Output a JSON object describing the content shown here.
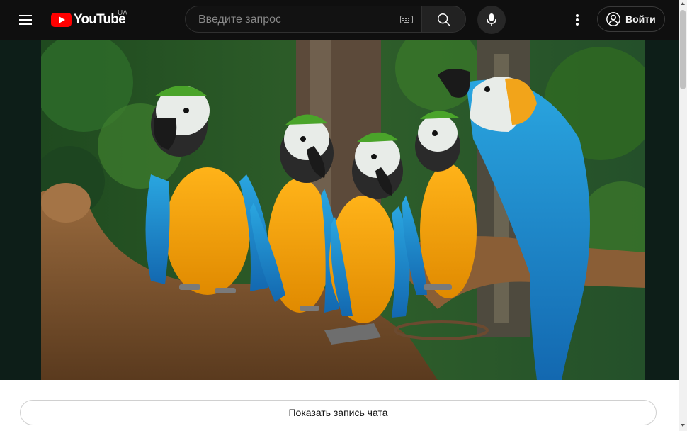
{
  "header": {
    "logo_text": "YouTube",
    "country_code": "UA",
    "search_placeholder": "Введите запрос",
    "signin_label": "Войти",
    "icons": [
      "menu-icon",
      "youtube-logo-icon",
      "keyboard-icon",
      "search-icon",
      "mic-icon",
      "more-vert-icon",
      "account-circle-icon"
    ]
  },
  "player": {
    "content_description_icon": "macaw-parrots-video-frame",
    "watermark_icon": "heart-watermark-icon"
  },
  "below_player": {
    "chat_replay_label": "Показать запись чата"
  },
  "colors": {
    "header_bg": "#0f0f0f",
    "brand_red": "#ff0000",
    "player_letterbox": "#0d1e18",
    "page_bg": "#ffffff"
  }
}
